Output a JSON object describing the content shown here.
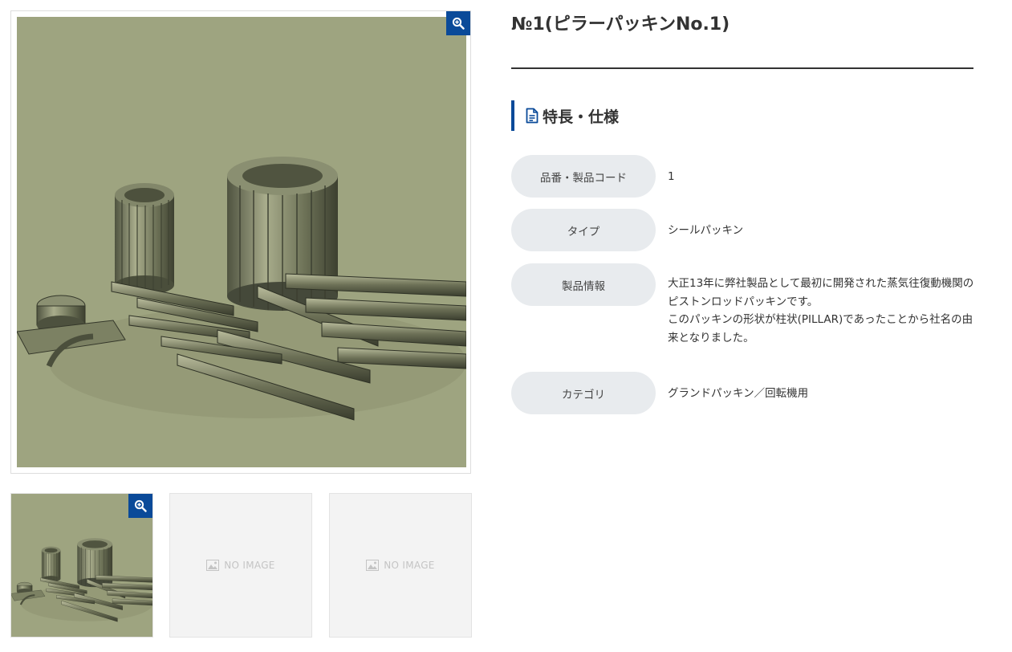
{
  "product": {
    "title": "№1(ピラーパッキンNo.1)",
    "image_alt": "ピラーパッキンNo.1"
  },
  "gallery": {
    "zoom_icon": "zoom-in-icon",
    "thumbnails": [
      {
        "type": "photo"
      },
      {
        "type": "placeholder",
        "text": "NO IMAGE"
      },
      {
        "type": "placeholder",
        "text": "NO IMAGE"
      }
    ]
  },
  "section": {
    "icon": "document-icon",
    "title": "特長・仕様"
  },
  "specs": [
    {
      "label": "品番・製品コード",
      "value": [
        "1"
      ]
    },
    {
      "label": "タイプ",
      "value": [
        "シールパッキン"
      ]
    },
    {
      "label": "製品情報",
      "value": [
        "大正13年に弊社製品として最初に開発された蒸気往復動機関のピストンロッドパッキンです。",
        "このパッキンの形状が柱状(PILLAR)であったことから社名の由来となりました。"
      ]
    },
    {
      "label": "カテゴリ",
      "value": [
        "グランドパッキン／回転機用"
      ]
    }
  ],
  "colors": {
    "accent": "#0a4a99",
    "photo_bg": "#9ea480",
    "label_bg": "#e8ebee",
    "placeholder_bg": "#f3f3f3"
  }
}
